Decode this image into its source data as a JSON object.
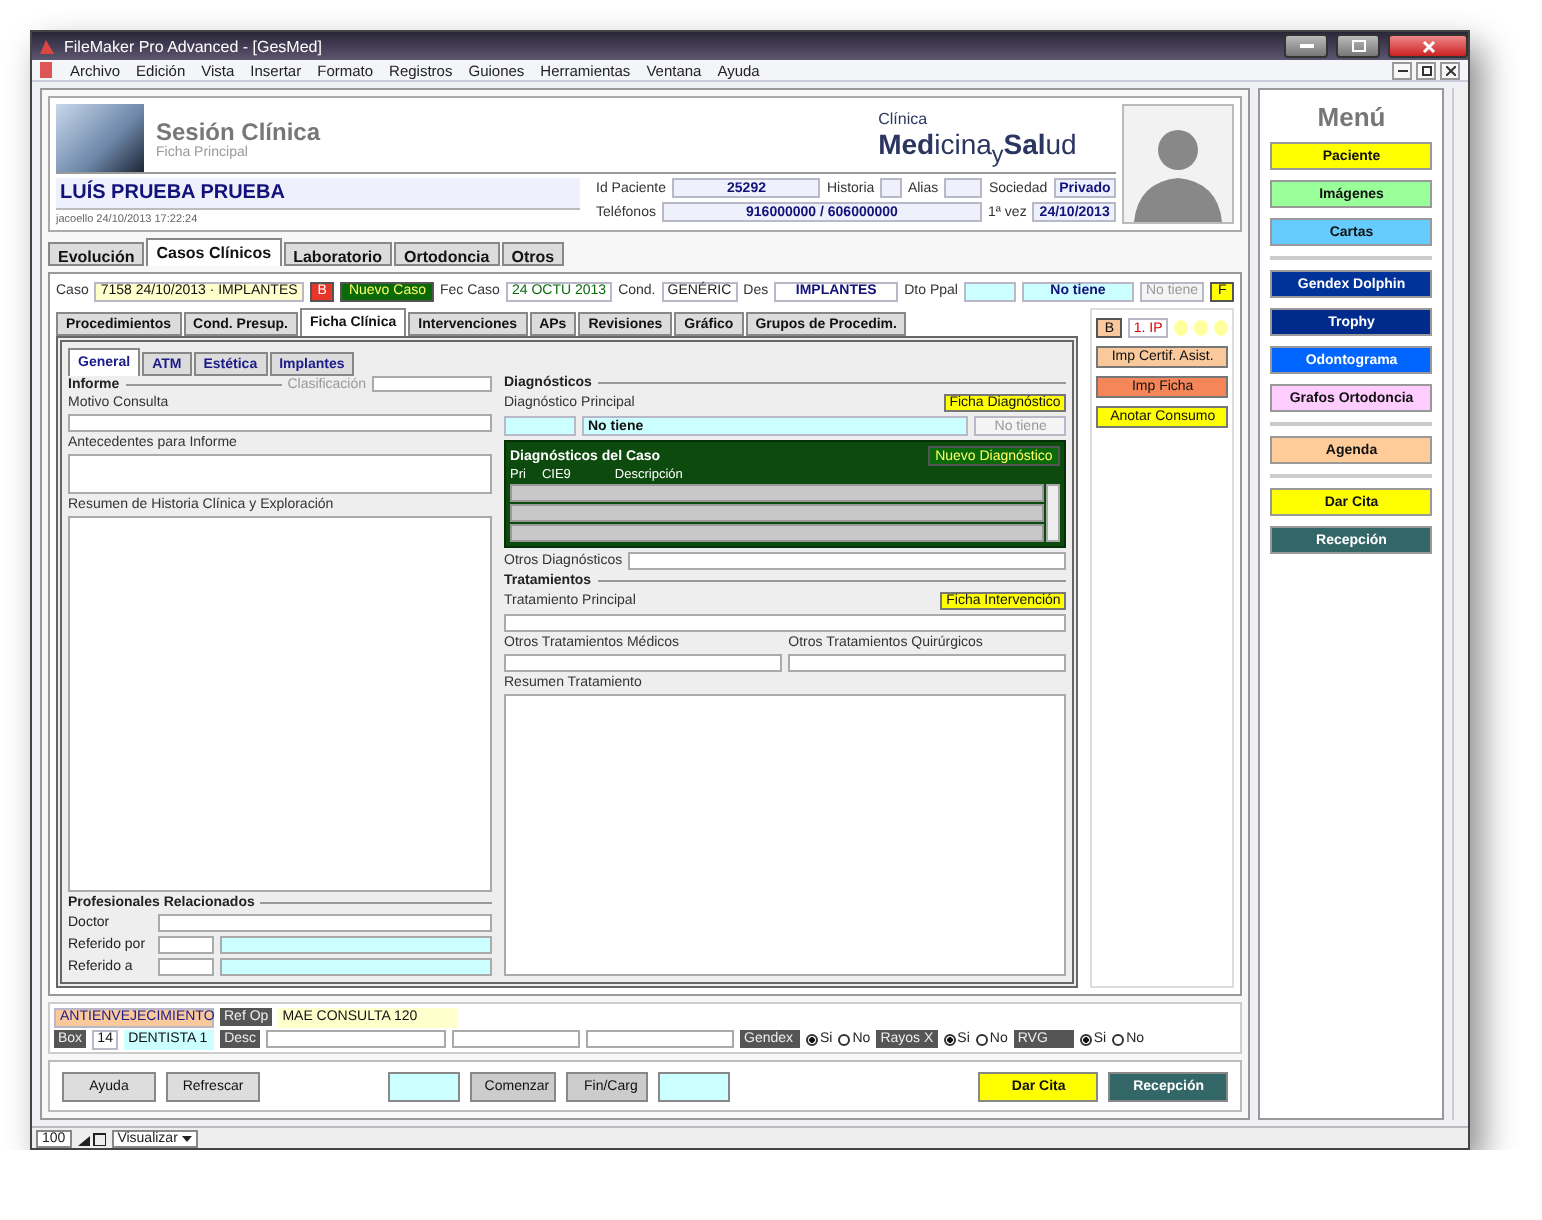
{
  "window": {
    "title": "FileMaker Pro Advanced - [GesMed]"
  },
  "menu_bar": [
    "Archivo",
    "Edición",
    "Vista",
    "Insertar",
    "Formato",
    "Registros",
    "Guiones",
    "Herramientas",
    "Ventana",
    "Ayuda"
  ],
  "header": {
    "title": "Sesión Clínica",
    "subtitle": "Ficha Principal",
    "logo_top": "Clínica",
    "logo_main": "**Med**icina$_{y}$**Sal**ud"
  },
  "patient": {
    "name": "LUÍS PRUEBA PRUEBA",
    "modified": "jacoello 24/10/2013 17:22:24",
    "field_rows": [
      [
        {
          "label": "Id Paciente",
          "value": "25292"
        },
        {
          "label": "Historia"
        },
        {
          "label": "Alias"
        },
        {
          "label": "Sociedad",
          "value": "Privado"
        }
      ],
      [
        {
          "label": "Teléfonos",
          "value": "916000000 / 606000000"
        },
        {
          "label": "1ª vez",
          "value": "24/10/2013"
        }
      ]
    ]
  },
  "main_tabs": [
    {
      "label": "Evolución",
      "selected": false
    },
    {
      "label": "Casos Clínicos",
      "selected": true
    },
    {
      "label": "Laboratorio",
      "selected": false
    },
    {
      "label": "Ortodoncia",
      "selected": false
    },
    {
      "label": "Otros",
      "selected": false
    }
  ],
  "case_bar": {
    "case_label": "Caso",
    "case_value": "7158 24/10/2013 · IMPLANTES",
    "b_button": "B",
    "new_case": "Nuevo Caso",
    "date_label": "Fec Caso",
    "date": "24 OCTU 2013",
    "cond_label": "Cond.",
    "cond": "GENÉRIC",
    "des_label": "Des",
    "des": "IMPLANTES",
    "dto_label": "Dto Ppal",
    "dto_value": "No tiene",
    "dto_other": "No tiene",
    "f_button": "F"
  },
  "sub_tabs": [
    {
      "label": "Procedimientos",
      "selected": false
    },
    {
      "label": "Cond. Presup.",
      "selected": false
    },
    {
      "label": "Ficha Clínica",
      "selected": true
    },
    {
      "label": "Intervenciones",
      "selected": false
    },
    {
      "label": "APs",
      "selected": false
    },
    {
      "label": "Revisiones",
      "selected": false
    },
    {
      "label": "Gráfico",
      "selected": false
    },
    {
      "label": "Grupos de Procedim.",
      "selected": false
    }
  ],
  "sub_side": {
    "b_button": "B",
    "ip": "1. IP"
  },
  "inner_tabs": [
    {
      "label": "General",
      "selected": true
    },
    {
      "label": "ATM",
      "selected": false
    },
    {
      "label": "Estética",
      "selected": false
    },
    {
      "label": "Implantes",
      "selected": false
    }
  ],
  "informe": {
    "title": "Informe",
    "classification_label": "Clasificación",
    "fields": [
      {
        "label": "Motivo Consulta",
        "kind": "line"
      },
      {
        "label": "Antecedentes para Informe",
        "kind": "box"
      },
      {
        "label": "Resumen de Historia Clínica y Exploración",
        "kind": "large"
      }
    ]
  },
  "professionals": {
    "title": "Profesionales Relacionados",
    "rows": [
      {
        "label": "Doctor",
        "kind": "single"
      },
      {
        "label": "Referido por",
        "kind": "pair"
      },
      {
        "label": "Referido a",
        "kind": "pair"
      }
    ]
  },
  "diagnostics": {
    "title": "Diagnósticos",
    "principal_label": "Diagnóstico Principal",
    "sheet_button": "Ficha Diagnóstico",
    "principal_value": "No tiene",
    "principal_other": "No tiene",
    "portal": {
      "title": "Diagnósticos del Caso",
      "new_button": "Nuevo Diagnóstico",
      "columns": [
        "Pri",
        "CIE9",
        "Descripción"
      ]
    },
    "other_label": "Otros Diagnósticos"
  },
  "treatments": {
    "title": "Tratamientos",
    "principal_label": "Tratamiento Principal",
    "sheet_button": "Ficha Intervención",
    "medical_label": "Otros Tratamientos Médicos",
    "surgical_label": "Otros Tratamientos Quirúrgicos",
    "summary_label": "Resumen Tratamiento"
  },
  "side_buttons": [
    {
      "label": "Imp Certif. Asist.",
      "color": "#f9c89b"
    },
    {
      "label": "Imp Ficha",
      "color": "#f4865a"
    },
    {
      "label": "Anotar Consumo",
      "color": "#ffff00"
    }
  ],
  "footer_strip": {
    "category": "ANTIENVEJECIMIENTO",
    "ref_label": "Ref Op",
    "ref_value": "MAE CONSULTA 120",
    "box_label": "Box",
    "box_value": "14",
    "box_name": "DENTISTA 1",
    "desc_label": "Desc",
    "imaging": [
      {
        "label": "Gendex",
        "options": [
          {
            "label": "Si",
            "selected": true
          },
          {
            "label": "No",
            "selected": false
          }
        ]
      },
      {
        "label": "Rayos X",
        "options": [
          {
            "label": "Si",
            "selected": true
          },
          {
            "label": "No",
            "selected": false
          }
        ]
      },
      {
        "label": "RVG",
        "options": [
          {
            "label": "Si",
            "selected": true
          },
          {
            "label": "No",
            "selected": false
          }
        ]
      }
    ]
  },
  "action_bar": {
    "left": [
      {
        "kind": "plain",
        "label": "Ayuda"
      },
      {
        "kind": "plain",
        "label": "Refrescar"
      }
    ],
    "center": [
      {
        "kind": "blank"
      },
      {
        "kind": "start",
        "label": "Comenzar"
      },
      {
        "kind": "stop",
        "label": "Fin/Carg"
      },
      {
        "kind": "blank"
      }
    ],
    "right": [
      {
        "kind": "appointment",
        "label": "Dar Cita"
      },
      {
        "kind": "reception",
        "label": "Recepción"
      }
    ]
  },
  "side_menu": {
    "title": "Menú",
    "groups": [
      [
        {
          "label": "Paciente",
          "color": "#ffff00"
        },
        {
          "label": "Imágenes",
          "color": "#99ff99"
        },
        {
          "label": "Cartas",
          "color": "#66ccff"
        }
      ],
      [
        {
          "label": "Gendex Dolphin",
          "color": "#003399"
        },
        {
          "label": "Trophy",
          "color": "#002a8c"
        },
        {
          "label": "Odontograma",
          "color": "#0066ff"
        },
        {
          "label": "Grafos Ortodoncia",
          "color": "#ffccff"
        }
      ],
      [
        {
          "label": "Agenda",
          "color": "#ffcc99"
        }
      ],
      [
        {
          "label": "Dar Cita",
          "color": "#ffff00"
        },
        {
          "label": "Recepción",
          "color": "#336666"
        }
      ]
    ]
  },
  "status_bar": {
    "zoom": "100",
    "mode": "Visualizar"
  }
}
